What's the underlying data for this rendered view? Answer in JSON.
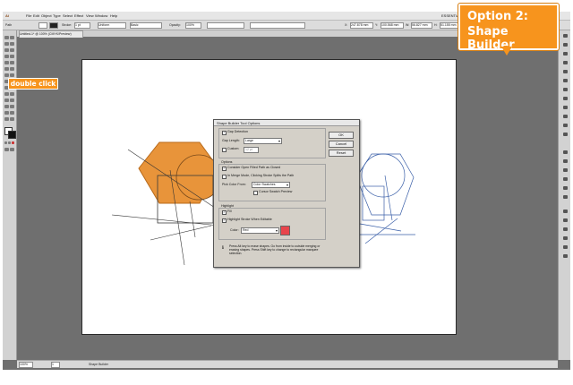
{
  "menu": {
    "items": [
      "Ai",
      "File",
      "Edit",
      "Object",
      "Type",
      "Select",
      "Effect",
      "View",
      "Window",
      "Help"
    ],
    "workspace": "ESSENTIALS ▾"
  },
  "control_bar": {
    "selection_label": "Path",
    "stroke_label": "Stroke:",
    "stroke_weight": "1 pt",
    "brush_label": "Uniform",
    "style_label": "Basic",
    "opacity_label": "Opacity:",
    "opacity_value": "100%",
    "x_label": "X:",
    "x_value": "247.878 mm",
    "y_label": "Y:",
    "y_value": "100.568 mm",
    "w_label": "W:",
    "w_value": "56.827 mm",
    "h_label": "H:",
    "h_value": "51.155 mm"
  },
  "document_tab": "Untitled-1* @ 100% (CMYK/Preview)",
  "status_bar": {
    "zoom": "100%",
    "page": "1",
    "tool_name": "Shape Builder"
  },
  "dialog": {
    "title": "Shape Builder Tool Options",
    "gap_detection_label": "Gap Detection",
    "gap_length_label": "Gap Length:",
    "gap_length_value": "Large",
    "custom_label": "Custom:",
    "custom_value": "12 pt",
    "options_label": "Options",
    "consider_open_fill_label": "Consider Open Filled Path as Closed",
    "merge_mode_label": "In Merge Mode, Clicking Stroke Splits the Path",
    "pick_color_label": "Pick Color From:",
    "pick_color_value": "Color Swatches",
    "cursor_preview_label": "Cursor Swatch Preview",
    "highlight_label": "Highlight",
    "fill_label": "Fill",
    "highlight_stroke_label": "Highlight Stroke When Editable",
    "color_label": "Color:",
    "color_value": "Red",
    "color_swatch": "#e8454c",
    "info_text": "Press Alt key to erase shapes. Go from inside to outside merging or erasing shapes. Press Shift key to change to rectangular marquee selection.",
    "ok_label": "OK",
    "cancel_label": "Cancel",
    "reset_label": "Reset"
  },
  "callouts": {
    "option_line1": "Option 2:",
    "option_line2": "Shape Builder",
    "double_click": "double click"
  },
  "colors": {
    "accent": "#f7941d",
    "hexagon_fill": "#e8943a",
    "hexagon_stroke": "#b86a1a",
    "selection_blue": "#3a5fa8"
  }
}
